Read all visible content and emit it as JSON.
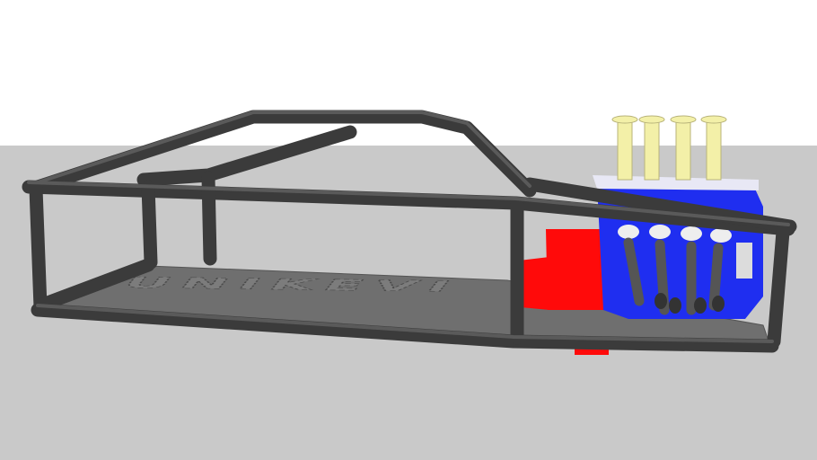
{
  "scene": {
    "sky_color": "#ffffff",
    "ground_color": "#c9c9c9",
    "tube_color": "#3b3b3b",
    "floor_color": "#6f6f6f",
    "engine_block_color": "#1f2ef0",
    "red_box_color": "#ff0a0a",
    "carb_color": "#f3f0a8",
    "exhaust_color": "#555555",
    "floor_logo_text": "UNIKEVI"
  }
}
